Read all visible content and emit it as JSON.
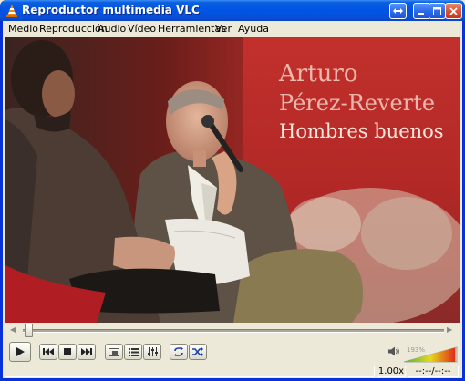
{
  "window": {
    "title": "Reproductor multimedia VLC"
  },
  "menu": {
    "items": [
      "Medio",
      "Reproducción",
      "Audio",
      "Vídeo",
      "Herramientas",
      "Ver",
      "Ayuda"
    ]
  },
  "video": {
    "banner_line1": "Arturo",
    "banner_line2": "Pérez-Reverte",
    "banner_line3": "Hombres buenos"
  },
  "controls": {
    "seek_position": 0.01,
    "volume_percent": "193%",
    "volume_level": 0.97
  },
  "status": {
    "message": "",
    "playback_rate": "1.00x",
    "time": "--:--/--:--"
  },
  "colors": {
    "titlebar": "#0054e3",
    "banner_red": "#b8292a",
    "volume_green": "#3cb84a",
    "volume_red": "#e0201a"
  }
}
